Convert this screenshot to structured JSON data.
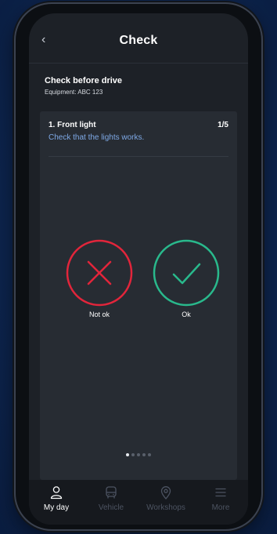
{
  "header": {
    "back_label": "‹",
    "title": "Check"
  },
  "intro": {
    "title": "Check before drive",
    "equipment": "Equipment: ABC 123"
  },
  "question": {
    "title": "1. Front light",
    "counter": "1/5",
    "description": "Check that the lights works."
  },
  "choices": {
    "not_ok": {
      "label": "Not ok",
      "color": "#e2253b",
      "icon": "close-x-icon"
    },
    "ok": {
      "label": "Ok",
      "color": "#29b98c",
      "icon": "checkmark-icon"
    }
  },
  "pager": {
    "total": 5,
    "current": 1
  },
  "nav": {
    "items": [
      {
        "label": "My day",
        "icon": "person-icon",
        "active": true
      },
      {
        "label": "Vehicle",
        "icon": "bus-icon",
        "active": false
      },
      {
        "label": "Workshops",
        "icon": "location-pin-icon",
        "active": false
      },
      {
        "label": "More",
        "icon": "menu-icon",
        "active": false
      }
    ]
  }
}
